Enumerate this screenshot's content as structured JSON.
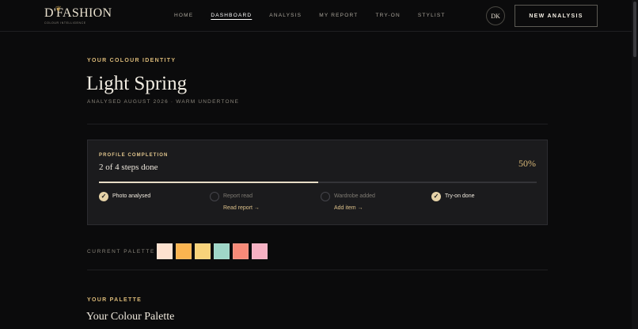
{
  "header": {
    "logo_text": "D'FASHION",
    "logo_tagline": "COLOUR INTELLIGENCE",
    "nav": [
      {
        "label": "HOME",
        "active": false
      },
      {
        "label": "DASHBOARD",
        "active": true
      },
      {
        "label": "ANALYSIS",
        "active": false
      },
      {
        "label": "MY REPORT",
        "active": false
      },
      {
        "label": "TRY-ON",
        "active": false
      },
      {
        "label": "STYLIST",
        "active": false
      }
    ],
    "avatar_initials": "DK",
    "new_analysis_label": "NEW ANALYSIS"
  },
  "identity": {
    "eyebrow": "YOUR COLOUR IDENTITY",
    "title": "Light Spring",
    "subtitle": "ANALYSED AUGUST 2026 · WARM UNDERTONE"
  },
  "completion": {
    "label": "PROFILE COMPLETION",
    "steps_text": "2 of 4 steps done",
    "percent_text": "50%",
    "progress_fraction": 0.5,
    "steps": [
      {
        "label": "Photo analysed",
        "done": true,
        "link": ""
      },
      {
        "label": "Report read",
        "done": false,
        "link": "Read report →"
      },
      {
        "label": "Wardrobe added",
        "done": false,
        "link": "Add item →"
      },
      {
        "label": "Try-on done",
        "done": true,
        "link": ""
      }
    ]
  },
  "current_palette": {
    "label": "CURRENT PALETTE",
    "swatches": [
      "#fde1cf",
      "#fbb450",
      "#f8d27a",
      "#9fd6c8",
      "#f78a78",
      "#f7b1c3"
    ]
  },
  "your_palette": {
    "eyebrow": "YOUR PALETTE",
    "title": "Your Colour Palette"
  },
  "colors": {
    "accent_gold": "#d9b877",
    "background": "#0b0b0c",
    "card": "#1b1b1d"
  }
}
